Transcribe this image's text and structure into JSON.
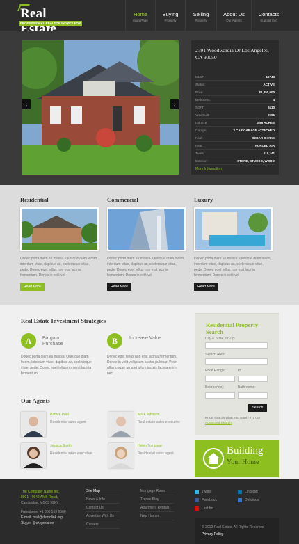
{
  "brand": {
    "name": "Real Estate",
    "tagline": "PROFESSIONAL REALTOR WORKS FOR YOU"
  },
  "nav": [
    {
      "label": "Home",
      "sub": "main Page"
    },
    {
      "label": "Buying",
      "sub": "Property"
    },
    {
      "label": "Selling",
      "sub": "Property"
    },
    {
      "label": "About Us",
      "sub": "Our Agents"
    },
    {
      "label": "Contacts",
      "sub": "Support Info"
    }
  ],
  "listing": {
    "address": "2791 Woodwardia Dr Los Angeles, CA 90050",
    "rows": [
      {
        "k": "MLS#:",
        "v": "16743"
      },
      {
        "k": "Status:",
        "v": "ACTIVE"
      },
      {
        "k": "Price:",
        "v": "$1,450,000"
      },
      {
        "k": "Bedrooms:",
        "v": "4"
      },
      {
        "k": "SQFT:",
        "v": "6110"
      },
      {
        "k": "Year Built:",
        "v": "2001"
      },
      {
        "k": "Lot Size:",
        "v": "3.56 ACRES"
      },
      {
        "k": "Garage:",
        "v": "3 CAR GARAGE ATTACHED"
      },
      {
        "k": "Roof:",
        "v": "CEDAR SHAKE"
      },
      {
        "k": "Heat:",
        "v": "FORCED AIR"
      },
      {
        "k": "Taxes:",
        "v": "$10,141"
      },
      {
        "k": "Exterior:",
        "v": "STONE, STUCCO, WOOD"
      }
    ],
    "more": "More Information",
    "prev": "‹",
    "next": "›"
  },
  "categories": [
    {
      "title": "Residential",
      "text": "Donec porta diem eu massa. Quisque diam lorem, interdum vitae, dapibus ac, scelerisque vitae, pede. Donec eget tellus non erat lacinia fermentum. Donec in velit vel",
      "btn": "Read More",
      "btnColor": "#8cbf1f"
    },
    {
      "title": "Commercial",
      "text": "Donec porta diem eu massa. Quisque diam lorem, interdum vitae, dapibus ac, scelerisque vitae, pede. Donec eget tellus non erat lacinia fermentum. Donec in velit vel",
      "btn": "Read More",
      "btnColor": "#1b1b1b"
    },
    {
      "title": "Luxury",
      "text": "Donec porta diem eu massa. Quisque diam lorem, interdum vitae, dapibus ac, scelerisque vitae, pede. Donec eget tellus non erat lacinia fermentum. Donec in velit vel",
      "btn": "Read More",
      "btnColor": "#1b1b1b"
    }
  ],
  "strategies": {
    "heading": "Real Estate Investment Strategies",
    "items": [
      {
        "letter": "A",
        "title": "Bargain Purchase",
        "text": "Donec porta diem eu massa. Quis que diam lorem, interdum vitae, dapibus ac, scelerisque vitae, pede. Donec eget tellus non erat lacinia fermentum."
      },
      {
        "letter": "B",
        "title": "Increase Value",
        "text": "Donec eget tellus non erat lacinia fermentum. Donec in velit vel ipsum auctor pulvinar. Proin ullamcorper urna et ullum iaculis lacinia enim nec."
      }
    ]
  },
  "agents": {
    "heading": "Our Agents",
    "items": [
      {
        "name": "Patrick Pool",
        "role": "Residential sales agent"
      },
      {
        "name": "Mark Johnson",
        "role": "Real estate sales executive"
      },
      {
        "name": "Jessica Smith",
        "role": "Residential sales executive"
      },
      {
        "name": "Helen Tompson",
        "role": "Residential sales agent"
      }
    ]
  },
  "search": {
    "title": "Residential Property Search",
    "city": "City & State, or Zip:",
    "area": "Search Area:",
    "price": "Price Range:",
    "to": "to:",
    "bedrooms": "Bedroom(s):",
    "bathrooms": "Bathrooms:",
    "button": "Search",
    "know": "Know exactly what you want? Try our",
    "adv": "Advanced Search"
  },
  "building": {
    "line1": "Building",
    "line2": "Your Home"
  },
  "footer": {
    "company": "The Company Name Inc.",
    "addr1": "8901 - 9542 AMB Road,",
    "addr2": "Cambridge, MG09 99KY",
    "phone": "Freephone:    +1 800 559 6580",
    "email": "E-mail: mail@demolink.org",
    "skype": "Skype: @skypename",
    "col1": [
      "Site Map",
      "News & Info",
      "Contact Us",
      "Advertise With Us",
      "Careers"
    ],
    "col2": [
      "Mortgage Rates",
      "Trends Blog",
      "Apartment Rentals",
      "New Homes"
    ],
    "social1": [
      "Twitter",
      "Facebook",
      "Last.fm"
    ],
    "social2": [
      "Linkedin",
      "Delicious"
    ],
    "copyright": "© 2012 Real Estate. All Rights Reserved",
    "privacy": "Privacy Policy"
  }
}
